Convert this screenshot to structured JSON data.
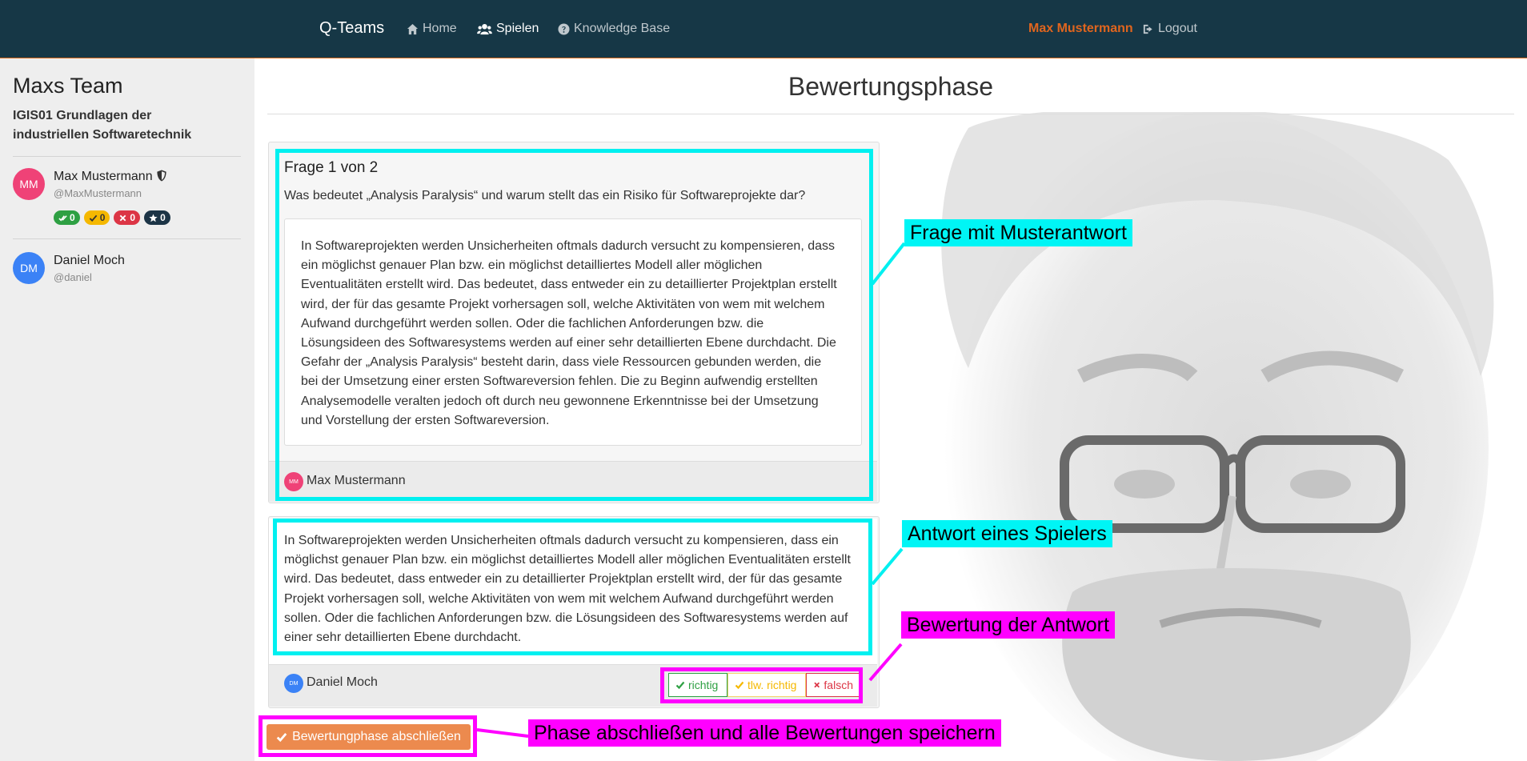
{
  "nav": {
    "brand": "Q-Teams",
    "home": "Home",
    "play": "Spielen",
    "kb": "Knowledge Base",
    "user": "Max Mustermann",
    "logout": "Logout"
  },
  "sidebar": {
    "team_name": "Maxs Team",
    "course": "IGIS01 Grundlagen der industriellen Softwaretechnik",
    "members": [
      {
        "initials": "MM",
        "name": "Max Mustermann",
        "handle": "@MaxMustermann",
        "color": "#ef4277"
      },
      {
        "initials": "DM",
        "name": "Daniel Moch",
        "handle": "@daniel",
        "color": "#3b82f6"
      }
    ],
    "badges": {
      "correct": "0",
      "partial": "0",
      "wrong": "0",
      "star": "0"
    }
  },
  "main": {
    "title": "Bewertungsphase",
    "question_header": "Frage 1 von 2",
    "question_text": "Was bedeutet „Analysis Paralysis“ und warum stellt das ein Risiko für Softwareprojekte dar?",
    "model_answer": "In Softwareprojekten werden Unsicherheiten oftmals dadurch versucht zu kompensieren, dass ein möglichst genauer Plan bzw. ein möglichst detailliertes Modell aller möglichen Eventualitäten erstellt wird. Das bedeutet, dass entweder ein zu detaillierter Projektplan erstellt wird, der für das gesamte Projekt vorhersagen soll, welche Aktivitäten von wem mit welchem Aufwand durchgeführt werden sollen. Oder die fachlichen Anforderungen bzw. die Lösungsideen des Softwaresystems werden auf einer sehr detaillierten Ebene durchdacht. Die Gefahr der „Analysis Paralysis“ besteht darin, dass viele Ressourcen gebunden werden, die bei der Umsetzung einer ersten Softwareversion fehlen. Die zu Beginn aufwendig erstellten Analysemodelle veralten jedoch oft durch neu gewonnene Erkenntnisse bei der Umsetzung und Vorstellung der ersten Softwareversion.",
    "question_author": {
      "initials": "MM",
      "name": "Max Mustermann"
    },
    "player_answer": "In Softwareprojekten werden Unsicherheiten oftmals dadurch versucht zu kompensieren, dass ein möglichst genauer Plan bzw. ein möglichst detailliertes Modell aller möglichen Eventualitäten erstellt wird. Das bedeutet, dass entweder ein zu detaillierter Projektplan erstellt wird, der für das gesamte Projekt vorhersagen soll, welche Aktivitäten von wem mit welchem Aufwand durchgeführt werden sollen. Oder die fachlichen Anforderungen bzw. die Lösungsideen des Softwaresystems werden auf einer sehr detaillierten Ebene durchdacht.",
    "answer_author": {
      "initials": "DM",
      "name": "Daniel Moch"
    },
    "rating": {
      "correct": "richtig",
      "partial": "tlw. richtig",
      "wrong": "falsch"
    },
    "finish_button": "Bewertungphase abschließen"
  },
  "annotations": {
    "question": "Frage mit Musterantwort",
    "answer": "Antwort eines Spielers",
    "rating": "Bewertung der Antwort",
    "finish": "Phase abschließen und alle Bewertungen speichern"
  },
  "colors": {
    "navbar": "#163746",
    "accent_orange": "#e0651e",
    "highlight_cyan": "#00f0f0",
    "highlight_magenta": "#ff00ff",
    "badge_green": "#2ea043",
    "badge_yellow": "#f5b800",
    "badge_red": "#dc3545",
    "badge_dark": "#1c3446"
  }
}
